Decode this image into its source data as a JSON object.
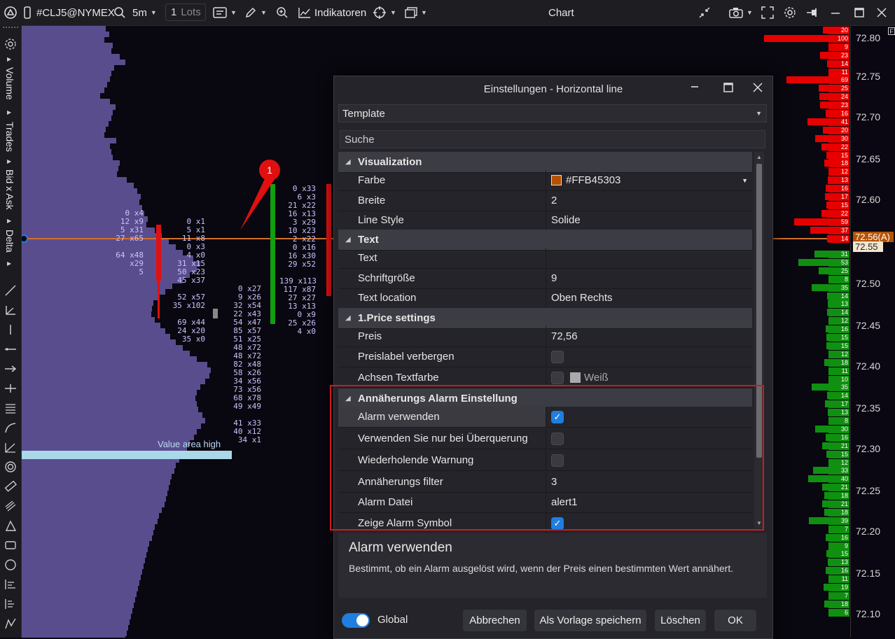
{
  "topbar": {
    "symbol": "#CLJ5@NYMEX",
    "timeframe": "5m",
    "lots_value": "1",
    "lots_label": "Lots",
    "indicators_label": "Indikatoren",
    "window_title": "Chart"
  },
  "left_toolbar": {
    "tabs": [
      "Volume",
      "Trades",
      "Bid x Ask",
      "Delta"
    ]
  },
  "chart": {
    "value_area_label": "Value area high",
    "marker_badge": "1",
    "footprint_columns": [
      {
        "lines": [
          "0 x4",
          "12 x9",
          "5 x31",
          "27 x65",
          "",
          "64 x48",
          "x29",
          "5"
        ]
      },
      {
        "lines": [
          "0 x1",
          "5 x1",
          "11 x8",
          "0 x3",
          "4 x0",
          "31 x15",
          "50 x23",
          "45 x37",
          "",
          "52 x57",
          "35 x102",
          "",
          "69 x44",
          "24 x20",
          "35 x0"
        ]
      },
      {
        "lines": [
          "0 x27",
          "9 x26",
          "32 x54",
          "22 x43",
          "54 x47",
          "85 x57",
          "51 x25",
          "48 x72",
          "48 x72",
          "82 x48",
          "58 x26",
          "34 x56",
          "73 x56",
          "68 x78",
          "49 x49",
          "",
          "41 x33",
          "40 x12",
          "34 x1"
        ]
      },
      {
        "lines": [
          "0 x33",
          "6 x3",
          "21 x22",
          "16 x13",
          "3 x29",
          "10 x23",
          "2 x22",
          "0 x16",
          "16 x30",
          "29 x52",
          "",
          "139 x113",
          "117 x87",
          "27 x27",
          "13 x13",
          "0 x9",
          "25 x26",
          "4 x0"
        ]
      }
    ]
  },
  "price_scale": {
    "labels": [
      "72.80",
      "72.75",
      "72.70",
      "72.65",
      "72.60",
      "72.50",
      "72.45",
      "72.40",
      "72.35",
      "72.30",
      "72.25",
      "72.20",
      "72.15",
      "72.10"
    ],
    "line_price_label": "72.56",
    "line_label_suffix": "(A)",
    "last_price_label": "72.55",
    "flag": "F",
    "ask_counts": [
      "20",
      "100",
      "9",
      "23",
      "14",
      "11",
      "69",
      "25",
      "24",
      "23",
      "16",
      "41",
      "20",
      "30",
      "22",
      "15",
      "18",
      "12",
      "13",
      "16",
      "17",
      "15",
      "22",
      "59",
      "37",
      "14"
    ],
    "bid_counts": [
      "31",
      "53",
      "25",
      "8",
      "35",
      "14",
      "13",
      "14",
      "12",
      "16",
      "15",
      "15",
      "12",
      "18",
      "11",
      "10",
      "35",
      "14",
      "17",
      "13",
      "8",
      "30",
      "16",
      "21",
      "15",
      "12",
      "33",
      "40",
      "21",
      "18",
      "21",
      "18",
      "39",
      "7",
      "16",
      "9",
      "15",
      "13",
      "16",
      "11",
      "19",
      "7",
      "18",
      "6"
    ],
    "colors": {
      "ask": "#e60000",
      "bid": "#109010"
    }
  },
  "dialog": {
    "title": "Einstellungen - Horizontal line",
    "template_label": "Template",
    "search_placeholder": "Suche",
    "sections": {
      "visualization": "Visualization",
      "text": "Text",
      "price": "1.Price settings",
      "alarm": "Annäherungs Alarm Einstellung"
    },
    "rows": {
      "farbe": {
        "label": "Farbe",
        "value": "#FFB45303",
        "swatch": "#b45303"
      },
      "breite": {
        "label": "Breite",
        "value": "2"
      },
      "linestyle": {
        "label": "Line Style",
        "value": "Solide"
      },
      "text": {
        "label": "Text",
        "value": ""
      },
      "schrift": {
        "label": "Schriftgröße",
        "value": "9"
      },
      "textloc": {
        "label": "Text location",
        "value": "Oben Rechts"
      },
      "preis": {
        "label": "Preis",
        "value": "72,56"
      },
      "preislabel": {
        "label": "Preislabel verbergen",
        "checked": false
      },
      "achsen": {
        "label": "Achsen Textfarbe",
        "value": "Weiß"
      },
      "alarm": {
        "label": "Alarm verwenden",
        "checked": true
      },
      "ueber": {
        "label": "Verwenden Sie nur bei Überquerung",
        "checked": false
      },
      "wieder": {
        "label": "Wiederholende Warnung",
        "checked": false
      },
      "filter": {
        "label": "Annäherungs filter",
        "value": "3"
      },
      "datei": {
        "label": "Alarm Datei",
        "value": "alert1"
      },
      "symbol": {
        "label": "Zeige Alarm Symbol",
        "checked": true
      }
    },
    "description_title": "Alarm verwenden",
    "description_text": "Bestimmt, ob ein Alarm ausgelöst wird, wenn der Preis einen bestimmten Wert annähert.",
    "global_label": "Global",
    "global_on": true,
    "buttons": {
      "cancel": "Abbrechen",
      "save_template": "Als Vorlage speichern",
      "delete": "Löschen",
      "ok": "OK"
    },
    "highlight_color": "#d11a1a"
  }
}
